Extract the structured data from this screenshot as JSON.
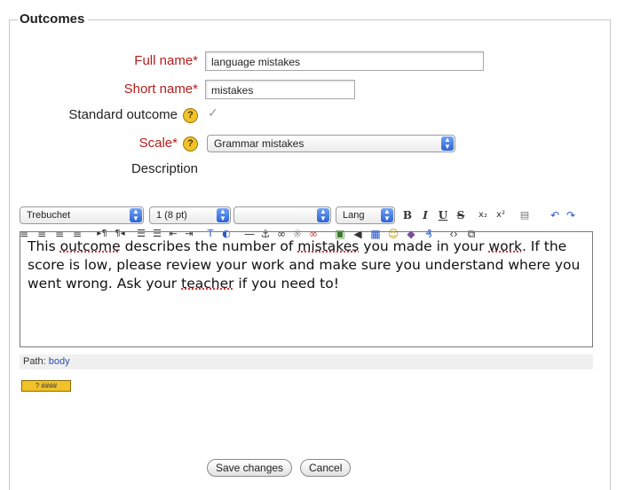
{
  "form": {
    "legend": "Outcomes",
    "full_name": {
      "label": "Full name",
      "required_mark": "*",
      "value": "language mistakes"
    },
    "short_name": {
      "label": "Short name",
      "required_mark": "*",
      "value": "mistakes"
    },
    "standard_outcome": {
      "label": "Standard outcome",
      "checked": true
    },
    "scale": {
      "label": "Scale",
      "required_mark": "*",
      "value": "Grammar mistakes"
    },
    "description_label": "Description",
    "help_glyph": "?"
  },
  "editor": {
    "font_select": "Trebuchet",
    "size_select": "1 (8 pt)",
    "format_select": "",
    "lang_select": "Lang",
    "content": {
      "line1": [
        "This ",
        "outcome",
        " describes the number of ",
        "mistakes",
        " you made in your ",
        "work",
        ". If the"
      ],
      "line2": [
        "score is low, please review your work and make sure you understand where you"
      ],
      "line3": [
        "went wrong. Ask your ",
        "teacher",
        " if you need to!"
      ]
    },
    "path_label": "Path:",
    "path_value": "body",
    "html_toggle": "?"
  },
  "buttons": {
    "save": "Save changes",
    "cancel": "Cancel"
  }
}
